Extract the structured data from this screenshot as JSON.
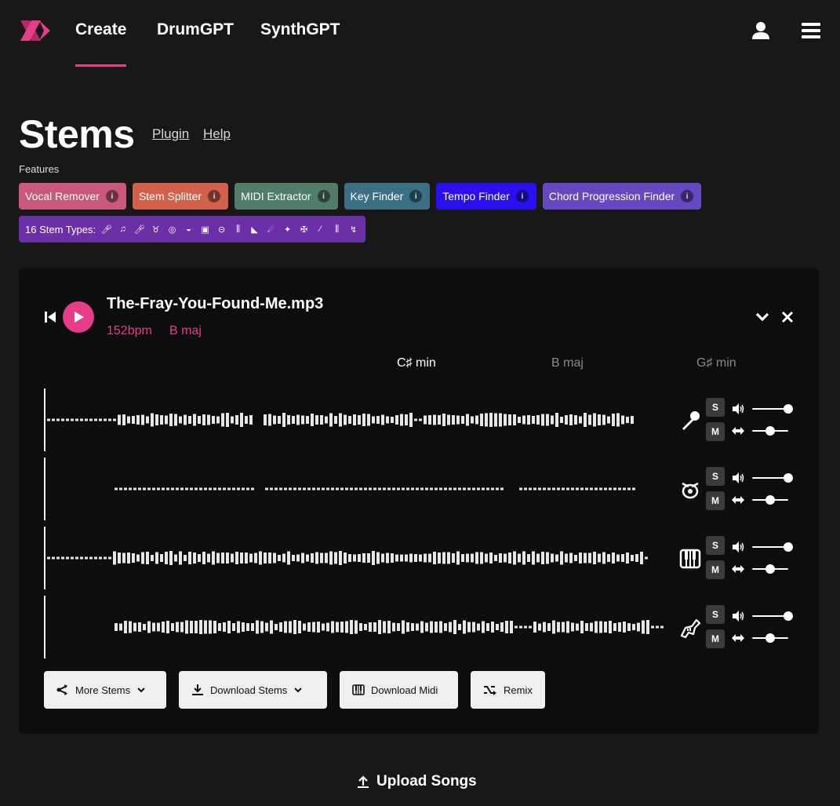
{
  "nav": {
    "links": [
      "Create",
      "DrumGPT",
      "SynthGPT"
    ],
    "active": "Create",
    "accent": "#e73c8a"
  },
  "header": {
    "title": "Stems",
    "links": [
      "Plugin",
      "Help"
    ],
    "features_label": "Features"
  },
  "features": [
    {
      "label": "Vocal Remover",
      "info": "i",
      "color": "#c9587a"
    },
    {
      "label": "Stem Splitter",
      "info": "i",
      "color": "#d3604b"
    },
    {
      "label": "MIDI Extractor",
      "info": "i",
      "color": "#4f7d68"
    },
    {
      "label": "Key Finder",
      "info": "i",
      "color": "#3a6f86"
    },
    {
      "label": "Tempo Finder",
      "info": "i",
      "color": "#2a0ff0"
    },
    {
      "label": "Chord Progression Finder",
      "info": "i",
      "color": "#6648c0"
    }
  ],
  "stem_types": {
    "label": "16 Stem Types:",
    "color": "#6b2fa6",
    "icons": [
      "microphone-icon",
      "music-note-icon",
      "microphone-icon",
      "choir-icon",
      "drum-icon",
      "cymbal-icon",
      "snare-icon",
      "tom-icon",
      "piano-icon",
      "grand-piano-icon",
      "guitar-icon",
      "bass-guitar-icon",
      "electric-guitar-icon",
      "violin-icon",
      "keyboard-icon",
      "trumpet-icon"
    ]
  },
  "player": {
    "file_name": "The-Fray-You-Found-Me.mp3",
    "bpm": "152bpm",
    "key": "B maj",
    "chords": [
      {
        "label": "C♯ min",
        "current": true
      },
      {
        "label": "B maj",
        "current": false
      },
      {
        "label": "G♯ min",
        "current": false
      }
    ],
    "stems": [
      {
        "name": "vocals",
        "icon": "microphone-icon",
        "solo": "S",
        "mute": "M",
        "volume": 1.0,
        "pan": 0.5
      },
      {
        "name": "drums",
        "icon": "drum-icon",
        "solo": "S",
        "mute": "M",
        "volume": 1.0,
        "pan": 0.5
      },
      {
        "name": "piano",
        "icon": "piano-icon",
        "solo": "S",
        "mute": "M",
        "volume": 1.0,
        "pan": 0.5
      },
      {
        "name": "brass",
        "icon": "trumpet-icon",
        "solo": "S",
        "mute": "M",
        "volume": 1.0,
        "pan": 0.5
      }
    ],
    "buttons": {
      "more_stems": "More Stems",
      "download_stems": "Download Stems",
      "download_midi": "Download Midi",
      "remix": "Remix"
    }
  },
  "upload": {
    "label": "Upload Songs"
  }
}
